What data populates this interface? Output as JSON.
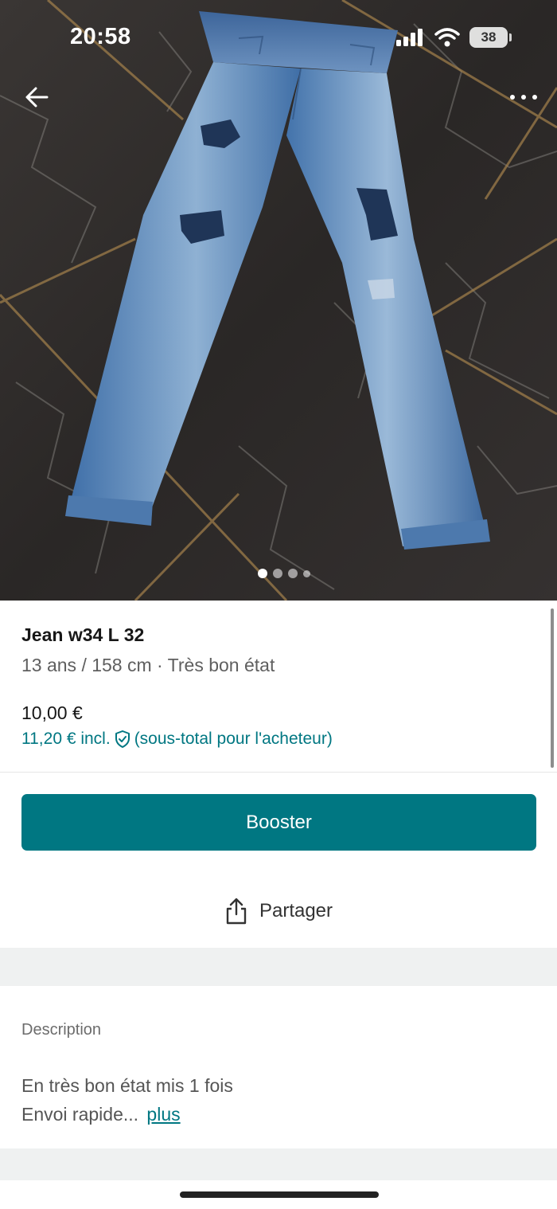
{
  "status_bar": {
    "time": "20:58",
    "battery": "38"
  },
  "nav": {
    "back_icon": "arrow-left-icon",
    "more_icon": "more-horizontal-icon"
  },
  "gallery": {
    "photo_count": 4,
    "active_index": 0
  },
  "item": {
    "title": "Jean w34 L 32",
    "subtitle": "13 ans / 158 cm · Très bon état",
    "price": "10,00 €",
    "price_incl": "11,20 € incl.",
    "price_incl_note": "(sous-total pour l'acheteur)"
  },
  "actions": {
    "booster_label": "Booster",
    "share_label": "Partager"
  },
  "description": {
    "label": "Description",
    "line1": "En très bon état mis 1 fois",
    "line2": "Envoi rapide...",
    "more_link": "plus"
  },
  "colors": {
    "accent": "#007782",
    "text": "#171717",
    "muted": "#5f5f5f",
    "band": "#eff1f1"
  }
}
